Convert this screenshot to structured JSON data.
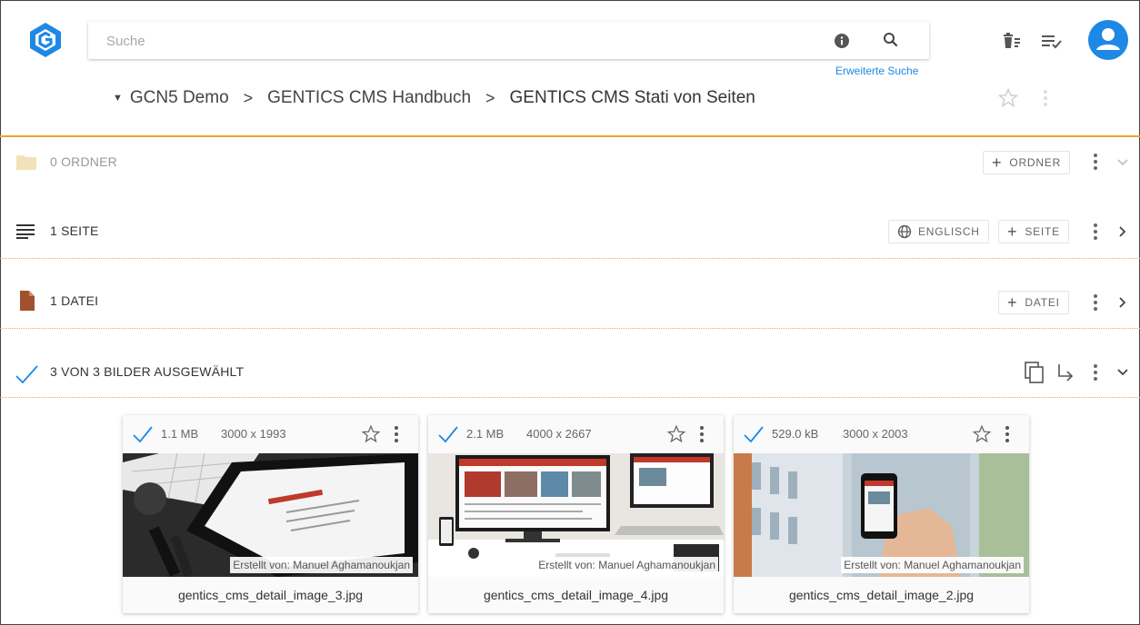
{
  "search": {
    "placeholder": "Suche",
    "advanced_link": "Erweiterte Suche"
  },
  "header_icons": {
    "info": "info-icon",
    "search": "search-icon",
    "trash": "trash-icon",
    "tasks": "tasklist-icon",
    "user": "account-icon"
  },
  "breadcrumb": {
    "items": [
      "GCN5 Demo",
      "GENTICS CMS Handbuch",
      "GENTICS CMS Stati von Seiten"
    ]
  },
  "sections": {
    "folders": {
      "title": "0 ORDNER",
      "add_label": "ORDNER"
    },
    "pages": {
      "title": "1 SEITE",
      "language_label": "ENGLISCH",
      "add_label": "SEITE"
    },
    "files": {
      "title": "1 DATEI",
      "add_label": "DATEI"
    },
    "images": {
      "title": "3 VON 3 BILDER AUSGEWÄHLT"
    }
  },
  "images": [
    {
      "size": "1.1 MB",
      "dimensions": "3000 x 1993",
      "credit": "Erstellt von: Manuel Aghamanoukjan",
      "filename": "gentics_cms_detail_image_3.jpg"
    },
    {
      "size": "2.1 MB",
      "dimensions": "4000 x 2667",
      "credit": "Erstellt von: Manuel Aghamanoukjan",
      "filename": "gentics_cms_detail_image_4.jpg"
    },
    {
      "size": "529.0 kB",
      "dimensions": "3000 x 2003",
      "credit": "Erstellt von: Manuel Aghamanoukjan",
      "filename": "gentics_cms_detail_image_2.jpg"
    }
  ],
  "colors": {
    "accent": "#1e88e5",
    "section_divider": "#f0a030",
    "folder": "#f3e1b9",
    "file": "#a0522d"
  }
}
